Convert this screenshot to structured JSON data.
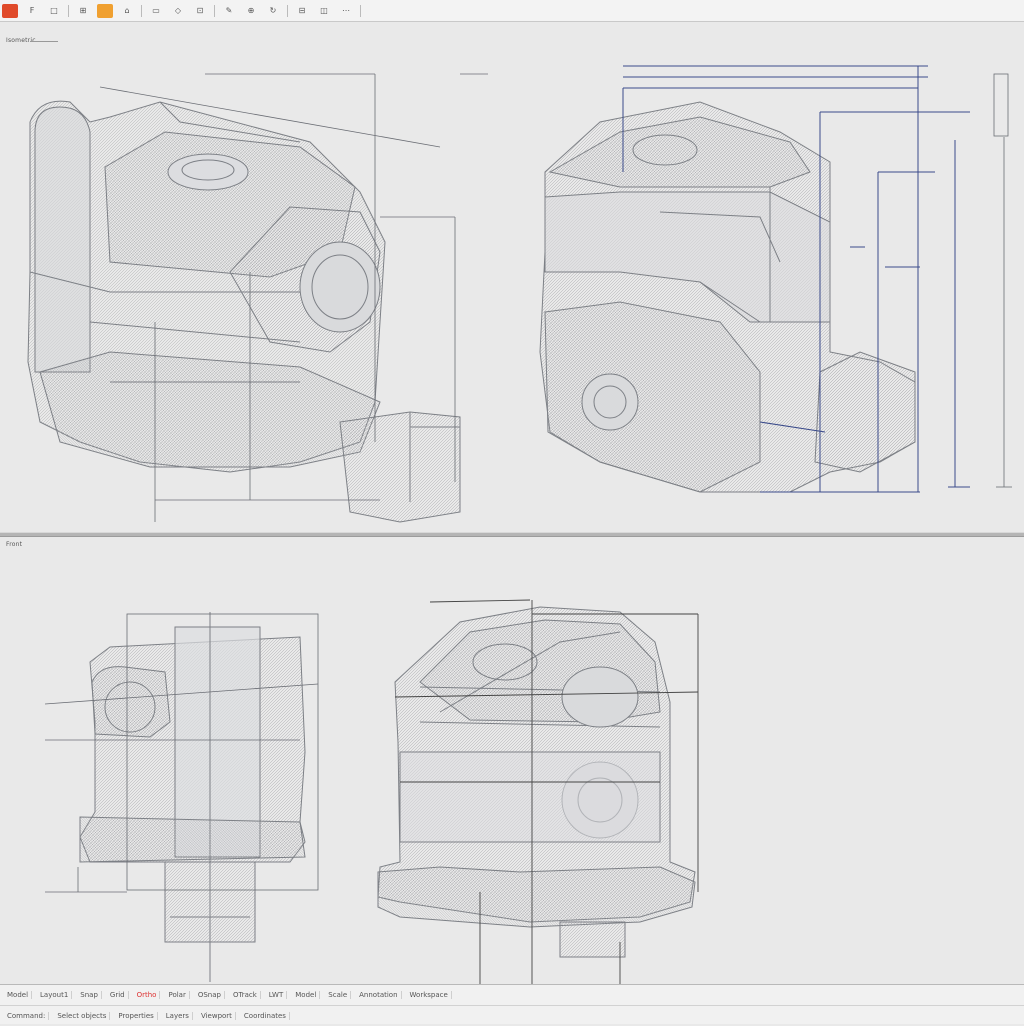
{
  "toolbar": {
    "buttons": [
      {
        "label": "",
        "style": "red",
        "icon": "app-icon"
      },
      {
        "label": "F",
        "style": "",
        "icon": "file-icon"
      },
      {
        "label": "□",
        "style": "",
        "icon": "new-icon"
      },
      {
        "label": "⊞",
        "style": "",
        "icon": "open-icon"
      },
      {
        "label": "",
        "style": "orange",
        "icon": "save-icon"
      },
      {
        "label": "⌂",
        "style": "",
        "icon": "home-icon"
      },
      {
        "label": "▭",
        "style": "",
        "icon": "window-icon"
      },
      {
        "label": "◇",
        "style": "",
        "icon": "shape-icon"
      },
      {
        "label": "⊡",
        "style": "",
        "icon": "zoom-icon"
      },
      {
        "label": "✎",
        "style": "",
        "icon": "edit-icon"
      },
      {
        "label": "⊕",
        "style": "",
        "icon": "add-icon"
      },
      {
        "label": "↻",
        "style": "",
        "icon": "rotate-icon"
      },
      {
        "label": "⊟",
        "style": "",
        "icon": "grid-icon"
      },
      {
        "label": "◫",
        "style": "",
        "icon": "layout-icon"
      },
      {
        "label": "⋯",
        "style": "",
        "icon": "more-icon"
      }
    ]
  },
  "views": {
    "top_label": "Isometric",
    "bottom_label": "Front"
  },
  "status": {
    "row1": [
      "Model",
      "Layout1",
      "Snap",
      "Grid",
      "Ortho",
      "Polar",
      "OSnap",
      "OTrack",
      "LWT",
      "Model",
      "Scale",
      "Annotation",
      "Workspace"
    ],
    "row2": [
      "Command:",
      "Select objects",
      "Properties",
      "Layers",
      "Viewport",
      "Coordinates"
    ]
  },
  "colors": {
    "wire": "#8d8f94",
    "dim": "#3a4a8a",
    "background": "#e9e9e9"
  }
}
